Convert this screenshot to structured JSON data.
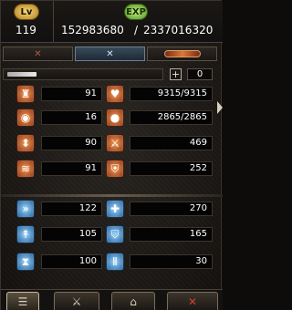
{
  "header": {
    "level_badge": "Lv",
    "exp_badge": "EXP",
    "level": "119",
    "exp_current": "152983680",
    "exp_separator": "/",
    "exp_max": "2337016320"
  },
  "tabs": [
    {
      "icon": "crossed-swords-icon",
      "glyph": "✕"
    },
    {
      "icon": "crossed-swords-icon",
      "glyph": "✕"
    },
    {
      "icon": "gem-icon",
      "glyph": ""
    }
  ],
  "points_bar": {
    "plus_label": "+",
    "points": "0"
  },
  "stats": [
    {
      "left_icon": "strength-icon",
      "left_glyph": "♜",
      "left_value": "91",
      "right_icon": "heart-icon",
      "right_glyph": "♥",
      "right_value": "9315/9315",
      "color": "orange"
    },
    {
      "left_icon": "head-icon",
      "left_glyph": "◉",
      "left_value": "16",
      "right_icon": "mana-orb-icon",
      "right_glyph": "●",
      "right_value": "2865/2865",
      "color": "orange"
    },
    {
      "left_icon": "boot-icon",
      "left_glyph": "⬍",
      "left_value": "90",
      "right_icon": "attack-icon",
      "right_glyph": "⚔",
      "right_value": "469",
      "color": "orange"
    },
    {
      "left_icon": "wing-icon",
      "left_glyph": "≋",
      "left_value": "91",
      "right_icon": "shield-icon",
      "right_glyph": "⛨",
      "right_value": "252",
      "color": "orange"
    },
    {
      "left_icon": "speed-icon",
      "left_glyph": "»",
      "left_value": "122",
      "right_icon": "critical-icon",
      "right_glyph": "✚",
      "right_value": "270",
      "color": "blue"
    },
    {
      "left_icon": "evasion-icon",
      "left_glyph": "↟",
      "left_value": "105",
      "right_icon": "defense-icon",
      "right_glyph": "⛉",
      "right_value": "165",
      "color": "blue"
    },
    {
      "left_icon": "hourglass-icon",
      "left_glyph": "⧗",
      "left_value": "100",
      "right_icon": "pierce-icon",
      "right_glyph": "Ⅱ",
      "right_value": "30",
      "color": "blue"
    }
  ],
  "bottom_buttons": [
    {
      "icon": "character-card-icon",
      "glyph": "☰"
    },
    {
      "icon": "sword-icon",
      "glyph": "⚔"
    },
    {
      "icon": "armor-icon",
      "glyph": "⌂"
    },
    {
      "icon": "potion-icon",
      "glyph": "✕"
    }
  ]
}
